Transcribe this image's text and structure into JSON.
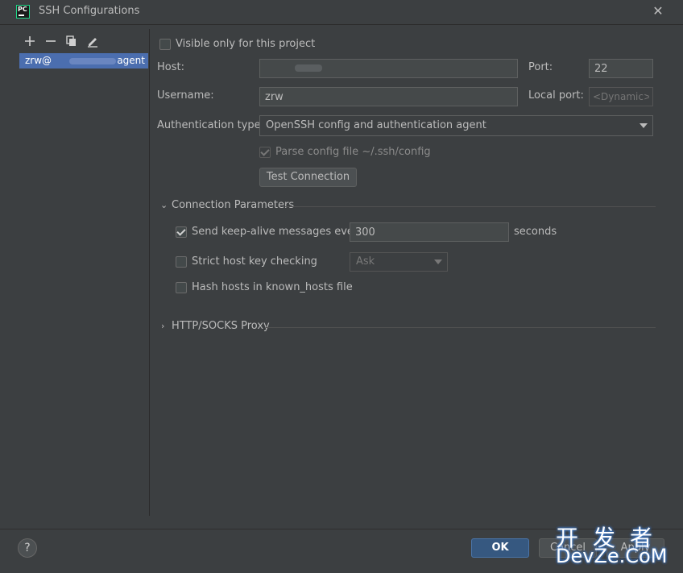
{
  "window": {
    "title": "SSH Configurations",
    "logo_text": "PC"
  },
  "toolbar": {
    "add": "+",
    "remove": "−"
  },
  "config_list": [
    {
      "label_prefix": "zrw@",
      "label_suffix": "agent",
      "selected": true
    }
  ],
  "form": {
    "visible_only_label": "Visible only for this project",
    "visible_only_checked": false,
    "host_label": "Host:",
    "host_value": "",
    "port_label": "Port:",
    "port_value": "22",
    "username_label": "Username:",
    "username_value": "zrw",
    "local_port_label": "Local port:",
    "local_port_placeholder": "<Dynamic>",
    "auth_type_label": "Authentication type:",
    "auth_type_value": "OpenSSH config and authentication agent",
    "parse_config_label": "Parse config file ~/.ssh/config",
    "parse_config_checked": true,
    "test_connection_label": "Test Connection"
  },
  "connection_params": {
    "header": "Connection Parameters",
    "keepalive_label": "Send keep-alive messages every",
    "keepalive_checked": true,
    "keepalive_value": "300",
    "keepalive_unit": "seconds",
    "strict_host_label": "Strict host key checking",
    "strict_host_checked": false,
    "strict_host_option": "Ask",
    "hash_hosts_label": "Hash hosts in known_hosts file",
    "hash_hosts_checked": false
  },
  "proxy": {
    "header": "HTTP/SOCKS Proxy"
  },
  "footer": {
    "help": "?",
    "ok": "OK",
    "cancel": "Cancel",
    "apply": "Apply"
  },
  "watermark": {
    "top": "开发者",
    "bottom": "DevZe.CoM"
  },
  "colors": {
    "background": "#3c3f41",
    "selection": "#4b6eaf",
    "ok_button": "#365880",
    "text": "#bbbbbb"
  }
}
